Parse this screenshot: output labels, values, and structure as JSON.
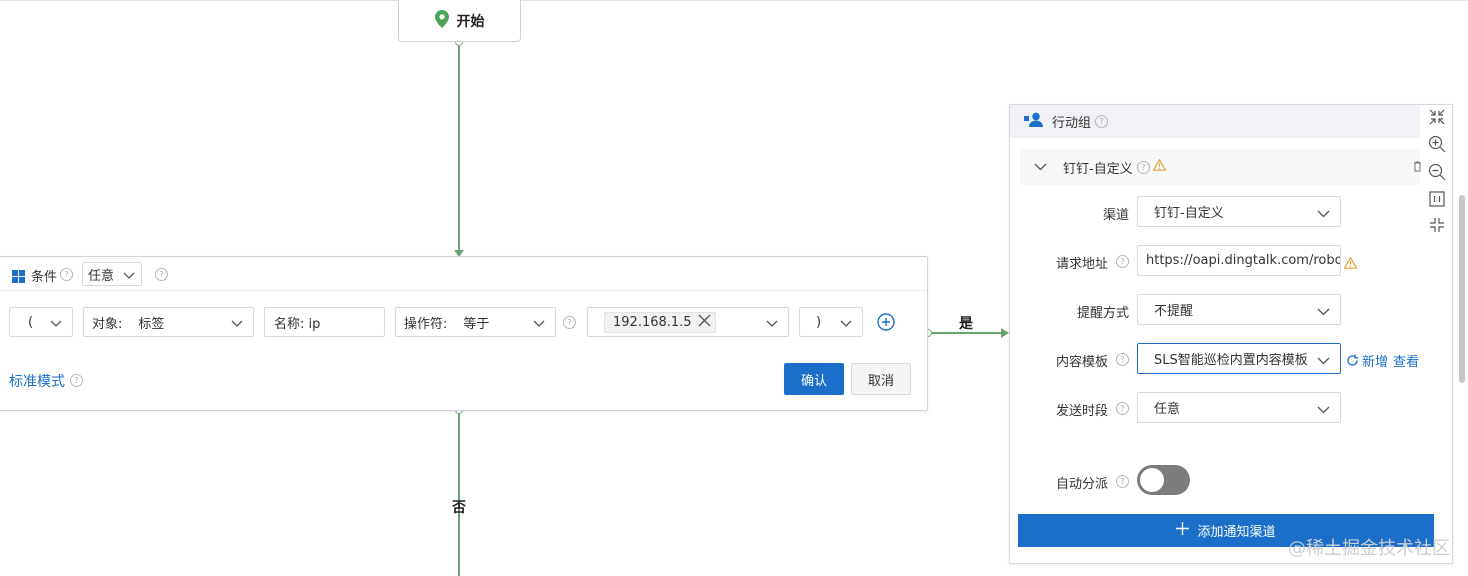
{
  "start": {
    "label": "开始",
    "icon": "map-pin-icon"
  },
  "edges": {
    "yes_label": "是",
    "no_label": "否"
  },
  "condition": {
    "title": "条件",
    "match_select": "任意",
    "row": {
      "open_paren": "(",
      "object_prefix": "对象:",
      "object_value": "标签",
      "name_field": "名称: ip",
      "operator_prefix": "操作符:",
      "operator_value": "等于",
      "value_tag": "192.168.1.5",
      "close_paren": ")"
    },
    "mode_link": "标准模式",
    "confirm_label": "确认",
    "cancel_label": "取消"
  },
  "action_group": {
    "title": "行动组",
    "channel_section_title": "钉钉-自定义",
    "fields": {
      "channel_label": "渠道",
      "channel_value": "钉钉-自定义",
      "url_label": "请求地址",
      "url_value": "https://oapi.dingtalk.com/robot/s",
      "remind_label": "提醒方式",
      "remind_value": "不提醒",
      "template_label": "内容模板",
      "template_value": "SLS智能巡检内置内容模板",
      "template_new": "新增",
      "template_view": "查看",
      "period_label": "发送时段",
      "period_value": "任意",
      "auto_assign_label": "自动分派",
      "auto_assign_on": false
    },
    "add_channel_label": "添加通知渠道"
  },
  "tools": [
    "collapse-icon",
    "zoom-in-icon",
    "zoom-out-icon",
    "fit-icon",
    "expand-icon"
  ],
  "watermark": "@稀土掘金技术社区",
  "colors": {
    "primary": "#1b6fc8",
    "connector": "#6aa36f",
    "warning": "#e6a23c"
  }
}
